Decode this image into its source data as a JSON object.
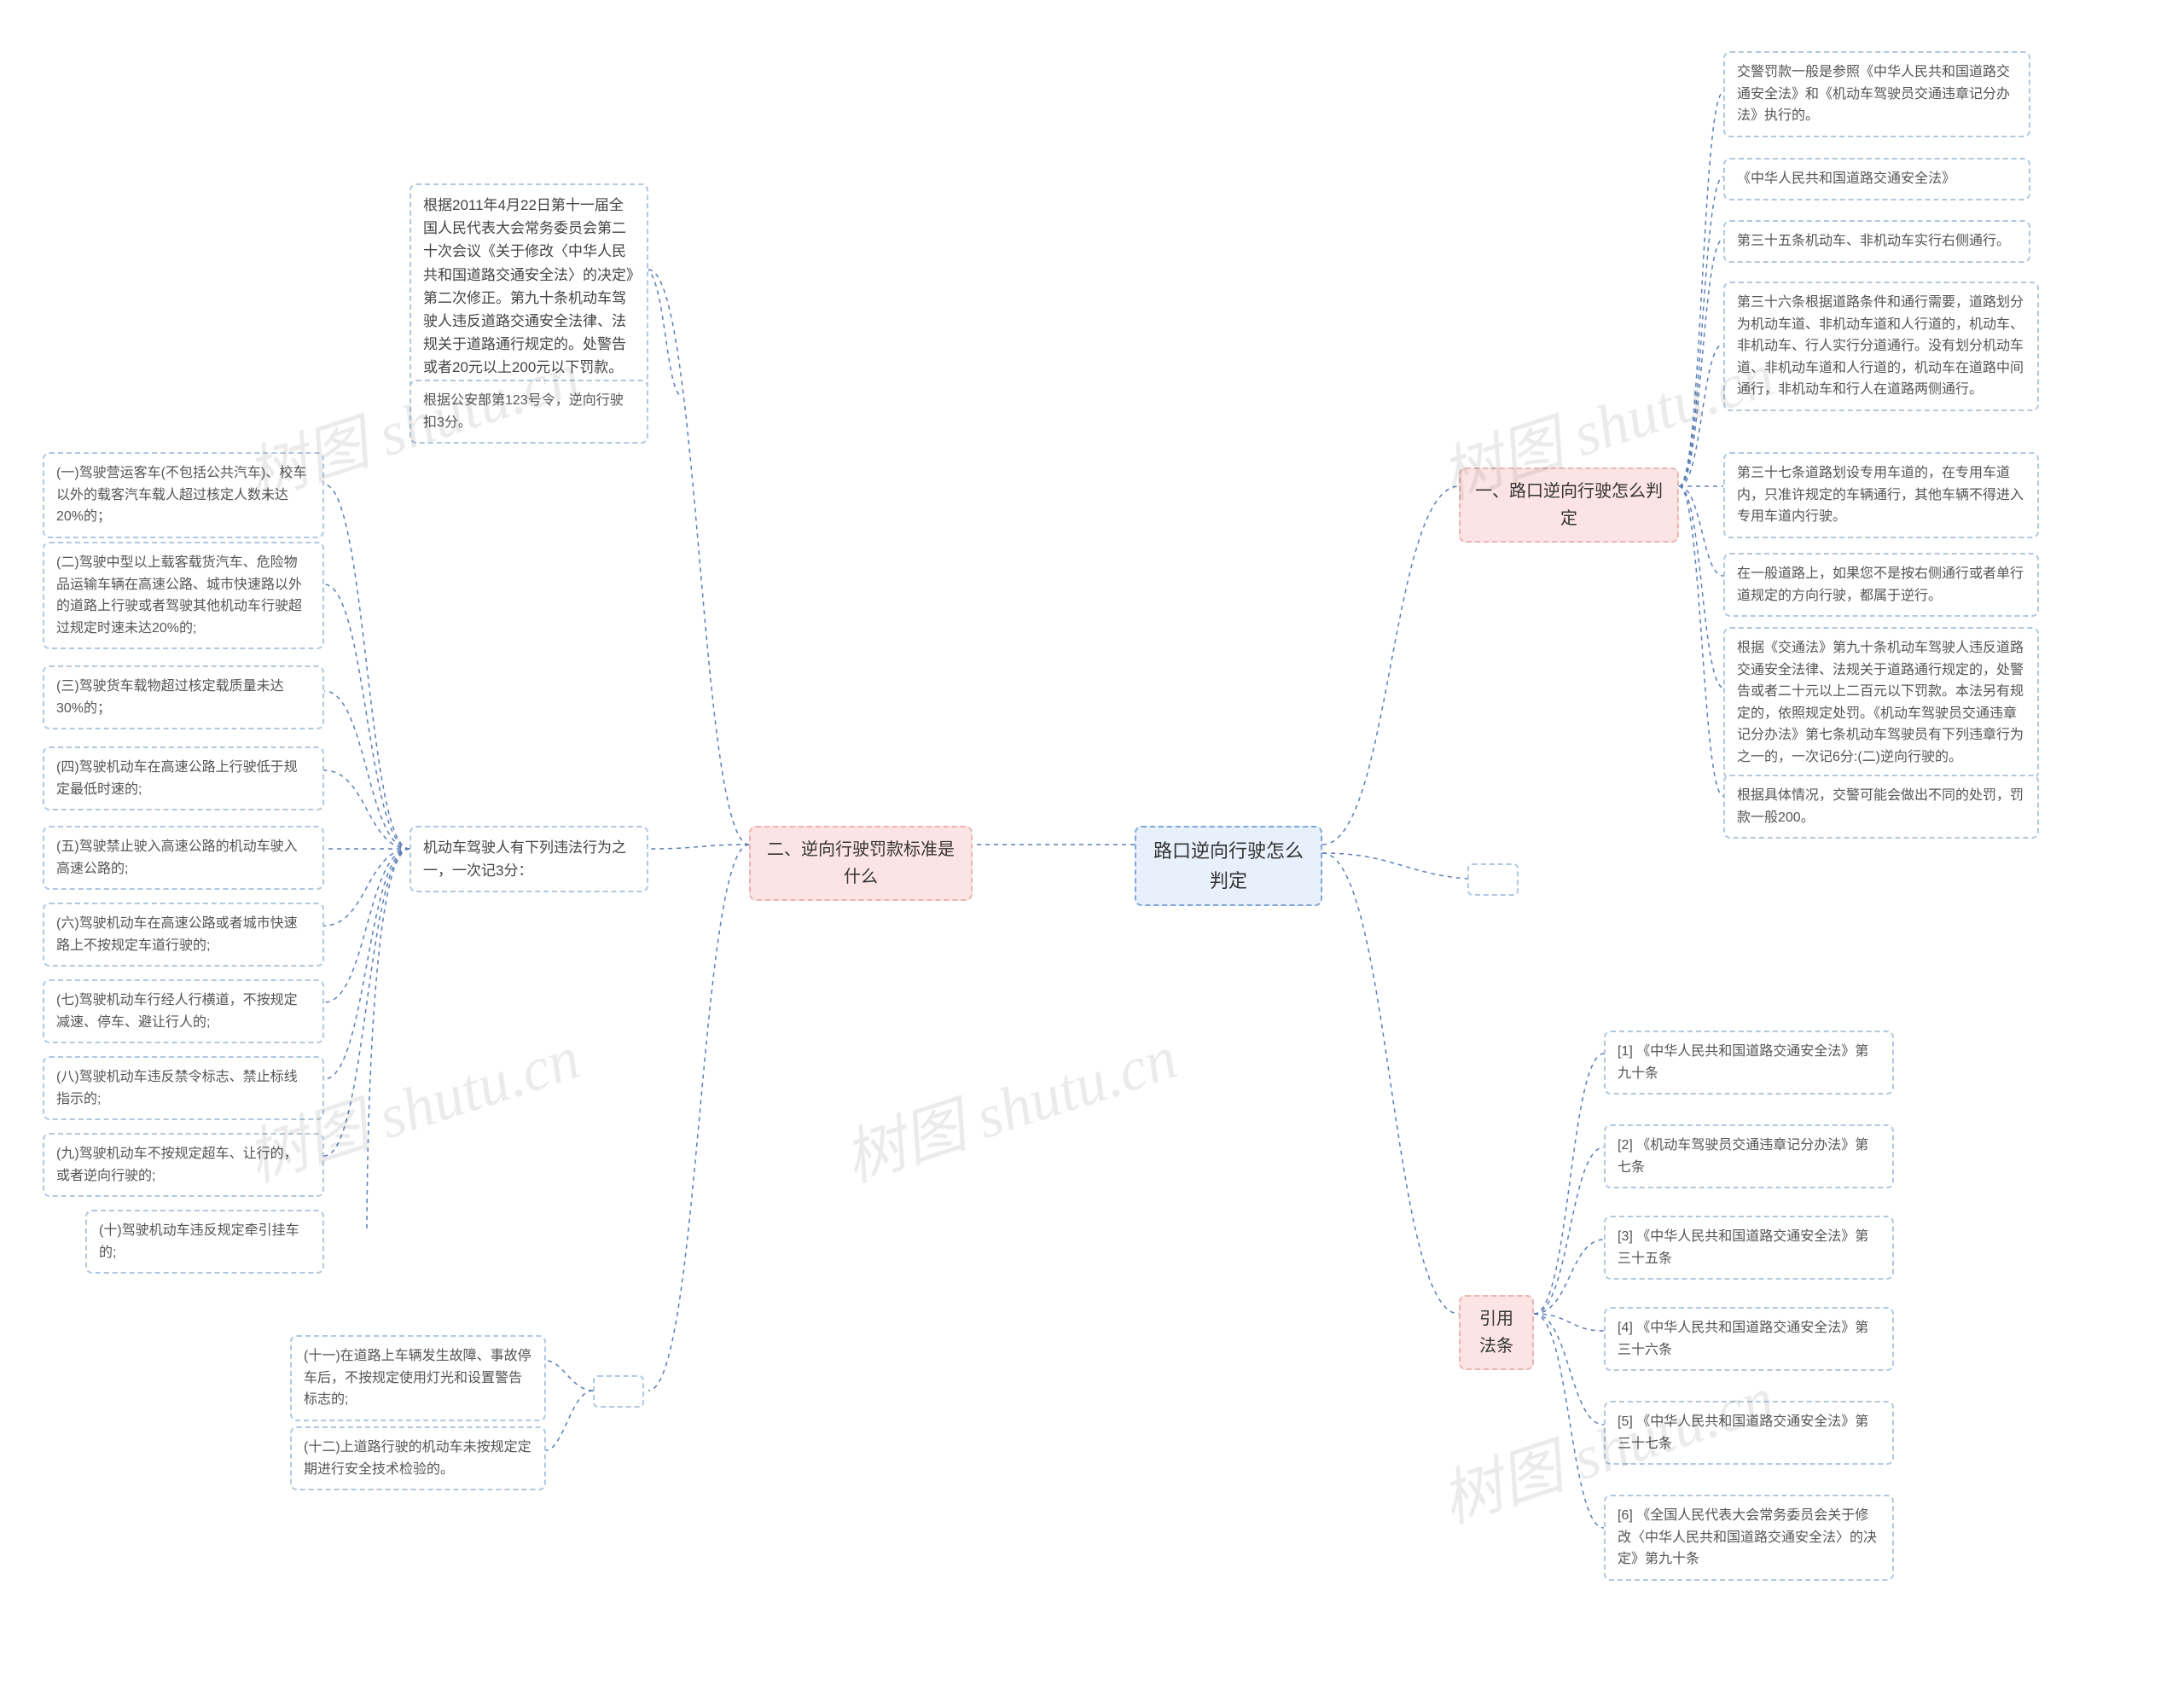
{
  "root": {
    "title": "路口逆向行驶怎么判定"
  },
  "branchA": {
    "title": "一、路口逆向行驶怎么判定",
    "leaves": [
      "交警罚款一般是参照《中华人民共和国道路交通安全法》和《机动车驾驶员交通违章记分办法》执行的。",
      "《中华人民共和国道路交通安全法》",
      "第三十五条机动车、非机动车实行右侧通行。",
      "第三十六条根据道路条件和通行需要，道路划分为机动车道、非机动车道和人行道的，机动车、非机动车、行人实行分道通行。没有划分机动车道、非机动车道和人行道的，机动车在道路中间通行，非机动车和行人在道路两侧通行。",
      "第三十七条道路划设专用车道的，在专用车道内，只准许规定的车辆通行，其他车辆不得进入专用车道内行驶。",
      "在一般道路上，如果您不是按右侧通行或者单行道规定的方向行驶，都属于逆行。",
      "根据《交通法》第九十条机动车驾驶人违反道路交通安全法律、法规关于道路通行规定的，处警告或者二十元以上二百元以下罚款。本法另有规定的，依照规定处罚。《机动车驾驶员交通违章记分办法》第七条机动车驾驶员有下列违章行为之一的，一次记6分:(二)逆向行驶的。",
      "根据具体情况，交警可能会做出不同的处罚，罚款一般200。"
    ]
  },
  "branchB": {
    "title": "二、逆向行驶罚款标准是什么",
    "sub1": {
      "text": "根据2011年4月22日第十一届全国人民代表大会常务委员会第二十次会议《关于修改〈中华人民共和国道路交通安全法〉的决定》第二次修正。第九十条机动车驾驶人违反道路交通安全法律、法规关于道路通行规定的。处警告或者20元以上200元以下罚款。本法另有规定的，依照规定处罚。",
      "child": "根据公安部第123号令，逆向行驶扣3分。"
    },
    "sub2": {
      "text": "机动车驾驶人有下列违法行为之一，一次记3分：",
      "children": [
        "(一)驾驶营运客车(不包括公共汽车)、校车以外的载客汽车载人超过核定人数未达20%的；",
        "(二)驾驶中型以上载客载货汽车、危险物品运输车辆在高速公路、城市快速路以外的道路上行驶或者驾驶其他机动车行驶超过规定时速未达20%的;",
        "(三)驾驶货车载物超过核定载质量未达30%的；",
        "(四)驾驶机动车在高速公路上行驶低于规定最低时速的;",
        "(五)驾驶禁止驶入高速公路的机动车驶入高速公路的;",
        "(六)驾驶机动车在高速公路或者城市快速路上不按规定车道行驶的;",
        "(七)驾驶机动车行经人行横道，不按规定减速、停车、避让行人的;",
        "(八)驾驶机动车违反禁令标志、禁止标线指示的;",
        "(九)驾驶机动车不按规定超车、让行的，或者逆向行驶的;",
        "(十)驾驶机动车违反规定牵引挂车的;"
      ]
    },
    "sub3_children": [
      "(十一)在道路上车辆发生故障、事故停车后，不按规定使用灯光和设置警告标志的;",
      "(十二)上道路行驶的机动车未按规定定期进行安全技术检验的。"
    ]
  },
  "branchC": {
    "title": "引用法条",
    "leaves": [
      "[1] 《中华人民共和国道路交通安全法》第九十条",
      "[2] 《机动车驾驶员交通违章记分办法》第七条",
      "[3] 《中华人民共和国道路交通安全法》第三十五条",
      "[4] 《中华人民共和国道路交通安全法》第三十六条",
      "[5] 《中华人民共和国道路交通安全法》第三十七条",
      "[6] 《全国人民代表大会常务委员会关于修改〈中华人民共和国道路交通安全法〉的决定》第九十条"
    ]
  },
  "watermarks": [
    "树图 shutu.cn",
    "树图 shutu.cn",
    "树图 shutu.cn",
    "树图 shutu.cn",
    "树图 shutu.cn"
  ]
}
